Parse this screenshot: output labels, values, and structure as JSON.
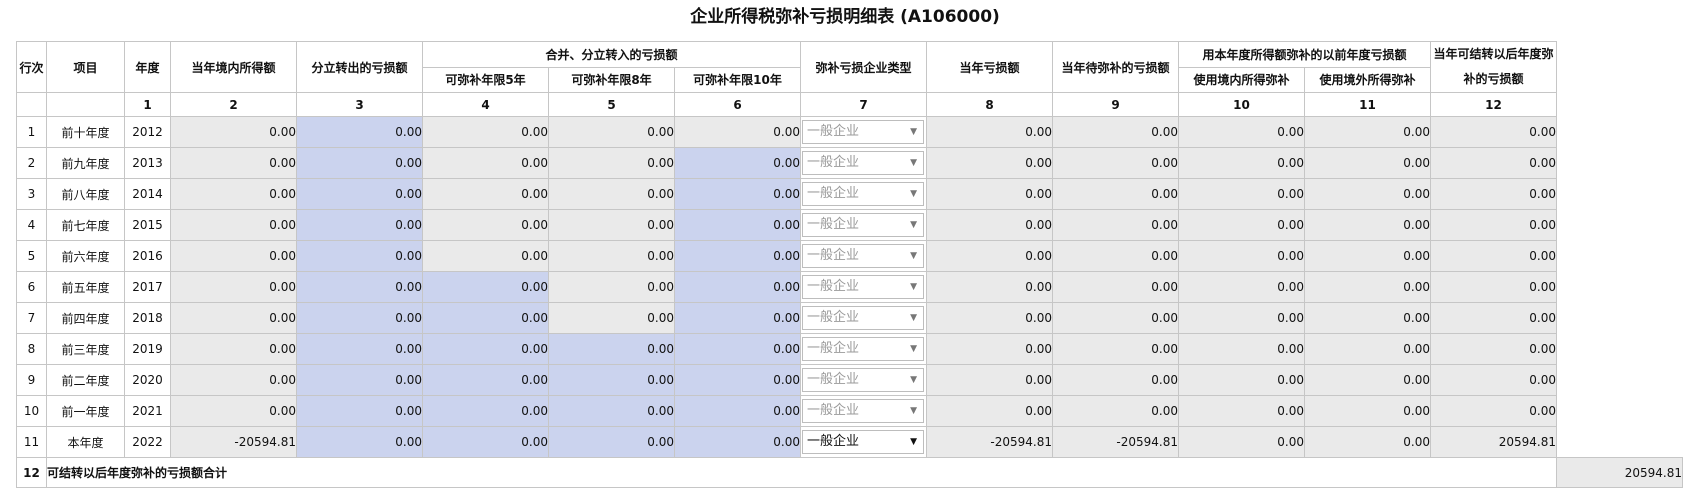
{
  "title": "企业所得税弥补亏损明细表 (A106000)",
  "headers": {
    "row": "行次",
    "project": "项目",
    "year": "年度",
    "c2": "当年境内所得额",
    "c3": "分立转出的亏损额",
    "merge_group": "合并、分立转入的亏损额",
    "c4": "可弥补年限5年",
    "c5": "可弥补年限8年",
    "c6": "可弥补年限10年",
    "c7": "弥补亏损企业类型",
    "c8": "当年亏损额",
    "c9": "当年待弥补的亏损额",
    "use_group": "用本年度所得额弥补的以前年度亏损额",
    "c10": "使用境内所得弥补",
    "c11": "使用境外所得弥补",
    "c12": "当年可结转以后年度弥补的亏损额"
  },
  "col_numbers": [
    "1",
    "2",
    "3",
    "4",
    "5",
    "6",
    "7",
    "8",
    "9",
    "10",
    "11",
    "12"
  ],
  "rows": [
    {
      "idx": "1",
      "proj": "前十年度",
      "year": "2012",
      "c2": "0.00",
      "c3": "0.00",
      "c4": "0.00",
      "c5": "0.00",
      "c6": "0.00",
      "type": "一般企业",
      "c8": "0.00",
      "c9": "0.00",
      "c10": "0.00",
      "c11": "0.00",
      "c12": "0.00"
    },
    {
      "idx": "2",
      "proj": "前九年度",
      "year": "2013",
      "c2": "0.00",
      "c3": "0.00",
      "c4": "0.00",
      "c5": "0.00",
      "c6": "0.00",
      "type": "一般企业",
      "c8": "0.00",
      "c9": "0.00",
      "c10": "0.00",
      "c11": "0.00",
      "c12": "0.00"
    },
    {
      "idx": "3",
      "proj": "前八年度",
      "year": "2014",
      "c2": "0.00",
      "c3": "0.00",
      "c4": "0.00",
      "c5": "0.00",
      "c6": "0.00",
      "type": "一般企业",
      "c8": "0.00",
      "c9": "0.00",
      "c10": "0.00",
      "c11": "0.00",
      "c12": "0.00"
    },
    {
      "idx": "4",
      "proj": "前七年度",
      "year": "2015",
      "c2": "0.00",
      "c3": "0.00",
      "c4": "0.00",
      "c5": "0.00",
      "c6": "0.00",
      "type": "一般企业",
      "c8": "0.00",
      "c9": "0.00",
      "c10": "0.00",
      "c11": "0.00",
      "c12": "0.00"
    },
    {
      "idx": "5",
      "proj": "前六年度",
      "year": "2016",
      "c2": "0.00",
      "c3": "0.00",
      "c4": "0.00",
      "c5": "0.00",
      "c6": "0.00",
      "type": "一般企业",
      "c8": "0.00",
      "c9": "0.00",
      "c10": "0.00",
      "c11": "0.00",
      "c12": "0.00"
    },
    {
      "idx": "6",
      "proj": "前五年度",
      "year": "2017",
      "c2": "0.00",
      "c3": "0.00",
      "c4": "0.00",
      "c5": "0.00",
      "c6": "0.00",
      "type": "一般企业",
      "c8": "0.00",
      "c9": "0.00",
      "c10": "0.00",
      "c11": "0.00",
      "c12": "0.00"
    },
    {
      "idx": "7",
      "proj": "前四年度",
      "year": "2018",
      "c2": "0.00",
      "c3": "0.00",
      "c4": "0.00",
      "c5": "0.00",
      "c6": "0.00",
      "type": "一般企业",
      "c8": "0.00",
      "c9": "0.00",
      "c10": "0.00",
      "c11": "0.00",
      "c12": "0.00"
    },
    {
      "idx": "8",
      "proj": "前三年度",
      "year": "2019",
      "c2": "0.00",
      "c3": "0.00",
      "c4": "0.00",
      "c5": "0.00",
      "c6": "0.00",
      "type": "一般企业",
      "c8": "0.00",
      "c9": "0.00",
      "c10": "0.00",
      "c11": "0.00",
      "c12": "0.00"
    },
    {
      "idx": "9",
      "proj": "前二年度",
      "year": "2020",
      "c2": "0.00",
      "c3": "0.00",
      "c4": "0.00",
      "c5": "0.00",
      "c6": "0.00",
      "type": "一般企业",
      "c8": "0.00",
      "c9": "0.00",
      "c10": "0.00",
      "c11": "0.00",
      "c12": "0.00"
    },
    {
      "idx": "10",
      "proj": "前一年度",
      "year": "2021",
      "c2": "0.00",
      "c3": "0.00",
      "c4": "0.00",
      "c5": "0.00",
      "c6": "0.00",
      "type": "一般企业",
      "c8": "0.00",
      "c9": "0.00",
      "c10": "0.00",
      "c11": "0.00",
      "c12": "0.00"
    },
    {
      "idx": "11",
      "proj": "本年度",
      "year": "2022",
      "c2": "-20594.81",
      "c3": "0.00",
      "c4": "0.00",
      "c5": "0.00",
      "c6": "0.00",
      "type": "一般企业",
      "c8": "-20594.81",
      "c9": "-20594.81",
      "c10": "0.00",
      "c11": "0.00",
      "c12": "20594.81"
    }
  ],
  "total": {
    "idx": "12",
    "label": "可结转以后年度弥补的亏损额合计",
    "value": "20594.81"
  },
  "colors": {
    "editable": "#cbd3ee",
    "readonly": "#eaeaea"
  }
}
